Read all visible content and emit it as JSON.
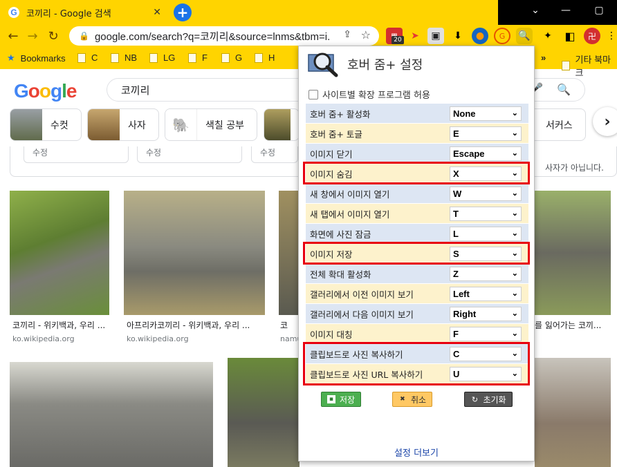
{
  "browser": {
    "tab_title": "코끼리 - Google 검색",
    "tab_favicon": "G",
    "new_tab": "+",
    "url": "google.com/search?q=코끼리&source=lnms&tbm=i...",
    "extension_badge": "20",
    "bookmarks": [
      "Bookmarks",
      "C",
      "NB",
      "LG",
      "F",
      "G",
      "H"
    ],
    "bookmarks_overflow": "»",
    "other_bookmarks": "기타 북마크"
  },
  "google": {
    "logo": "Google",
    "query": "코끼리",
    "chips": [
      "수컷",
      "사자",
      "색칠 공부",
      "서커스"
    ],
    "filters": [
      "수정",
      "수정",
      "수정"
    ],
    "not_found_text": "사자가 아닙니다.",
    "results": [
      {
        "caption": "코끼리 - 위키백과, 우리 ...",
        "source": "ko.wikipedia.org"
      },
      {
        "caption": "아프리카코끼리 - 위키백과, 우리 ...",
        "source": "ko.wikipedia.org"
      },
      {
        "caption": "코",
        "source": "namu"
      },
      {
        "caption": "를 잃어가는 코끼...",
        "source": ""
      }
    ]
  },
  "popup": {
    "title": "호버 줌+ 설정",
    "allow_label": "사이트별 확장 프로그램 허용",
    "rows": [
      {
        "label": "호버 줌+ 활성화",
        "value": "None",
        "color": "blue"
      },
      {
        "label": "호버 줌+ 토글",
        "value": "E",
        "color": "yellow"
      },
      {
        "label": "이미지 닫기",
        "value": "Escape",
        "color": "blue"
      },
      {
        "label": "이미지 숨김",
        "value": "X",
        "color": "yellow"
      },
      {
        "label": "새 창에서 이미지 열기",
        "value": "W",
        "color": "blue"
      },
      {
        "label": "새 탭에서 이미지 열기",
        "value": "T",
        "color": "yellow"
      },
      {
        "label": "화면에 사진 잠금",
        "value": "L",
        "color": "blue"
      },
      {
        "label": "이미지 저장",
        "value": "S",
        "color": "yellow"
      },
      {
        "label": "전체 확대 활성화",
        "value": "Z",
        "color": "blue"
      },
      {
        "label": "갤러리에서 이전 이미지 보기",
        "value": "Left",
        "color": "yellow"
      },
      {
        "label": "갤러리에서 다음 이미지 보기",
        "value": "Right",
        "color": "blue"
      },
      {
        "label": "이미지 대칭",
        "value": "F",
        "color": "yellow"
      },
      {
        "label": "클립보드로 사진 복사하기",
        "value": "C",
        "color": "blue"
      },
      {
        "label": "클립보드로 사진 URL 복사하기",
        "value": "U",
        "color": "yellow"
      }
    ],
    "save_label": "저장",
    "cancel_label": "취소",
    "reset_label": "초기화",
    "more_settings": "설정 더보기"
  },
  "colors": {
    "chrome_yellow": "#ffd400",
    "highlight_red": "#e8000f",
    "save_green": "#4caf50",
    "cancel_orange": "#ffc864",
    "reset_dark": "#555555"
  }
}
